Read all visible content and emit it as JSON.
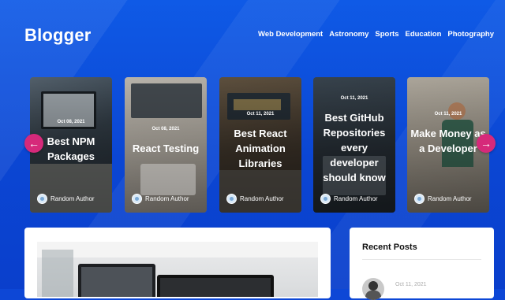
{
  "header": {
    "brand": "Blogger",
    "nav": [
      "Web Development",
      "Astronomy",
      "Sports",
      "Education",
      "Photography"
    ]
  },
  "carousel": {
    "cards": [
      {
        "date": "Oct 08, 2021",
        "title": "Best NPM Packages",
        "author": "Random Author"
      },
      {
        "date": "Oct 08, 2021",
        "title": "React Testing",
        "author": "Random Author"
      },
      {
        "date": "Oct 11, 2021",
        "title": "Best React Animation Libraries",
        "author": "Random Author"
      },
      {
        "date": "Oct 11, 2021",
        "title": "Best GitHub Repositories every developer should know",
        "author": "Random Author"
      },
      {
        "date": "Oct 11, 2021",
        "title": "Make Money as a Developer",
        "author": "Random Author"
      }
    ],
    "prev_icon": "arrow-left-icon",
    "next_icon": "arrow-right-icon",
    "prev_glyph": "←",
    "next_glyph": "→",
    "arrow_color": "#d6297a"
  },
  "sidebar": {
    "title": "Recent Posts",
    "first_date": "Oct 11, 2021"
  },
  "colors": {
    "background": "#0d47d6",
    "accent": "#d6297a"
  }
}
